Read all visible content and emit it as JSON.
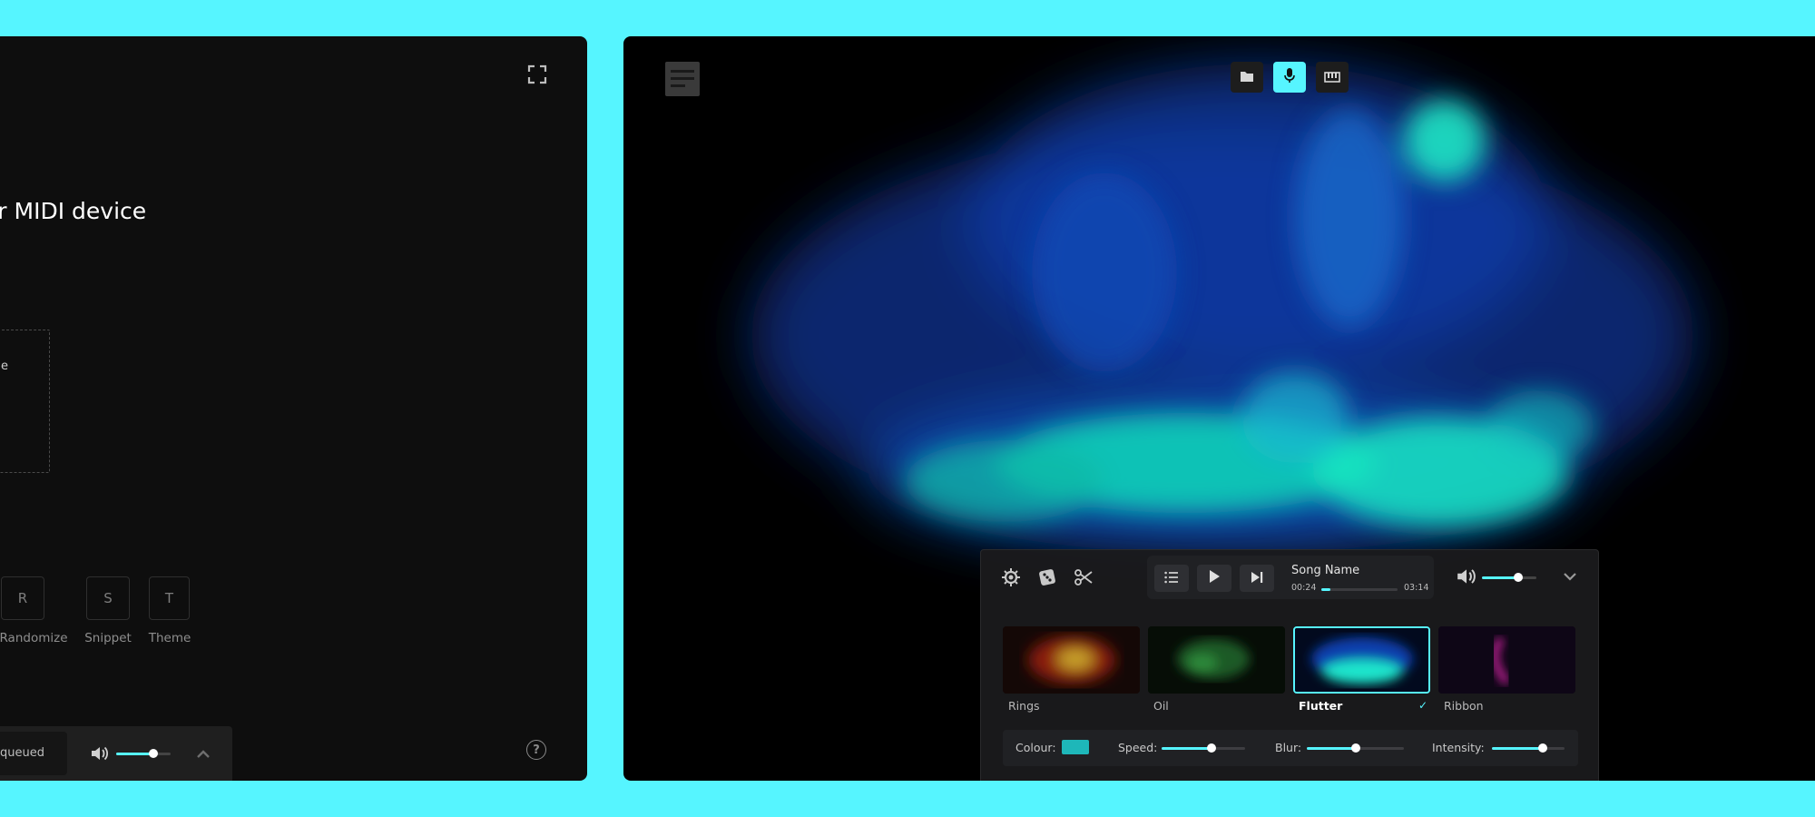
{
  "colors": {
    "background": "#56f5ff",
    "accent": "#56f5ff",
    "panel": "#0e0e0e",
    "swatch": "#1eb7b9"
  },
  "left_panel": {
    "title": "or MIDI device",
    "dropzone_text": "e",
    "keys": [
      {
        "key": "R",
        "label": "Randomize"
      },
      {
        "key": "S",
        "label": "Snippet"
      },
      {
        "key": "T",
        "label": "Theme"
      }
    ],
    "player": {
      "status": "queued",
      "volume": 0.68
    },
    "help_label": "?",
    "icons": [
      "fullscreen-icon",
      "volume-icon",
      "chevron-up-icon",
      "help-icon"
    ]
  },
  "right_panel": {
    "source_buttons": [
      {
        "name": "folder",
        "icon": "folder-icon",
        "active": false
      },
      {
        "name": "microphone",
        "icon": "microphone-icon",
        "active": true
      },
      {
        "name": "midi",
        "icon": "keyboard-icon",
        "active": false
      }
    ],
    "tools": [
      "settings-icon",
      "dice-icon",
      "scissors-icon"
    ],
    "player": {
      "song_name": "Song Name",
      "current_time": "00:24",
      "total_time": "03:14",
      "progress": 0.124
    },
    "volume": 0.66,
    "themes": [
      {
        "label": "Rings",
        "selected": false
      },
      {
        "label": "Oil",
        "selected": false
      },
      {
        "label": "Flutter",
        "selected": true
      },
      {
        "label": "Ribbon",
        "selected": false
      }
    ],
    "selected_check": "✓",
    "params": {
      "colour_label": "Colour:",
      "speed_label": "Speed:",
      "speed": 0.6,
      "blur_label": "Blur:",
      "blur": 0.5,
      "intensity_label": "Intensity:",
      "intensity": 0.7
    }
  }
}
